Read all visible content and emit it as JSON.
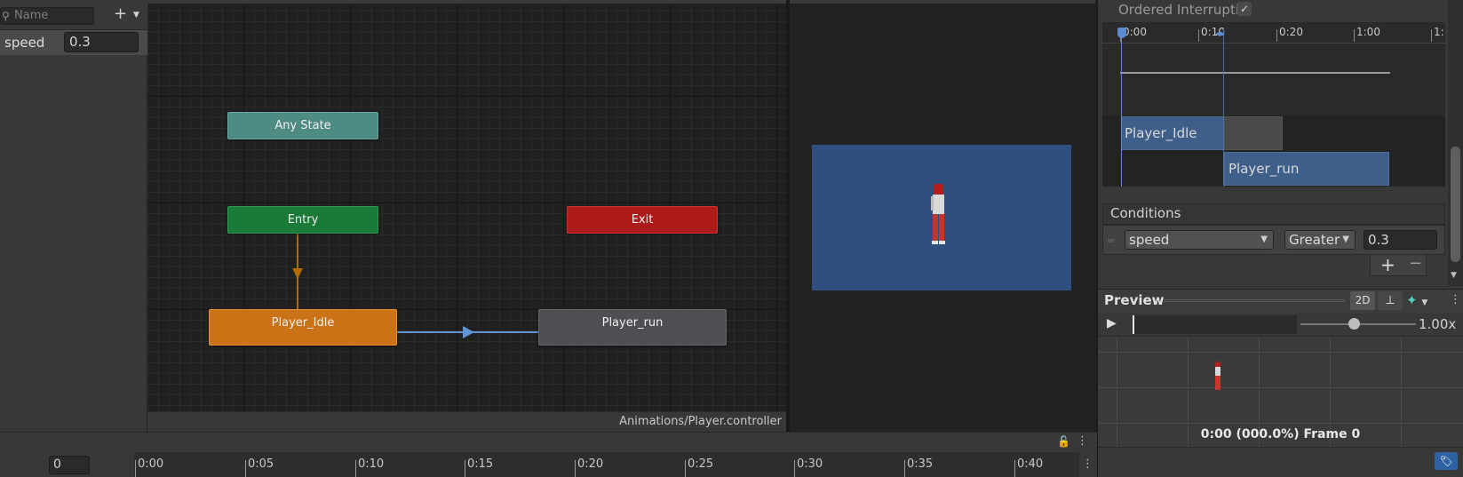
{
  "parameters": {
    "search_placeholder": "Name",
    "add_icon": "plus-icon",
    "items": [
      {
        "name": "speed",
        "value": "0.3"
      }
    ]
  },
  "graph": {
    "states": {
      "any": "Any State",
      "entry": "Entry",
      "exit": "Exit",
      "idle": "Player_Idle",
      "run": "Player_run"
    },
    "colors": {
      "any": "#4e8b83",
      "entry": "#1a7a37",
      "exit": "#ae1a1a",
      "idle_default": "#cb7116",
      "run": "#4e4f52",
      "transition": "#5e95d6",
      "entry_transition": "#b36b00"
    },
    "footer_path": "Animations/Player.controller"
  },
  "inspector": {
    "ordered_interruption_label": "Ordered Interruptic",
    "ordered_interruption_checked": true,
    "timeline": {
      "ticks": [
        "0:00",
        "0:10",
        "0:20",
        "1:00",
        "1:"
      ],
      "from_state": "Player_Idle",
      "to_state": "Player_run"
    },
    "conditions": {
      "title": "Conditions",
      "items": [
        {
          "parameter": "speed",
          "mode": "Greater",
          "threshold": "0.3"
        }
      ],
      "add_label": "+",
      "remove_label": "−"
    },
    "preview": {
      "title": "Preview",
      "mode_2d": "2D",
      "speed": "1.00x",
      "frame_status": "0:00 (000.0%) Frame 0"
    }
  },
  "timeline": {
    "frame": "0",
    "ticks": [
      "0:00",
      "0:05",
      "0:10",
      "0:15",
      "0:20",
      "0:25",
      "0:30",
      "0:35",
      "0:40"
    ]
  }
}
